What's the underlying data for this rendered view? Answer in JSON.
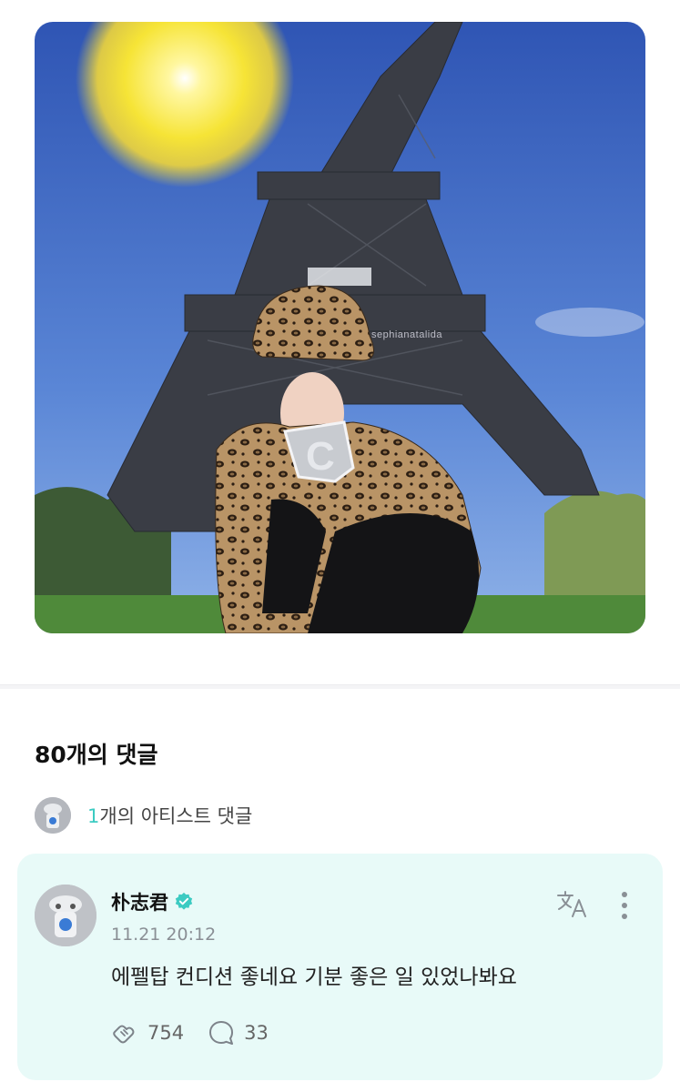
{
  "post": {
    "watermark": "sephianatalida"
  },
  "comments": {
    "count_label": "80개의 댓글",
    "artist_comments": {
      "count": "1",
      "label": "개의 아티스트 댓글"
    }
  },
  "comment": {
    "username": "朴志君",
    "timestamp": "11.21 20:12",
    "text": "에펠탑 컨디션 좋네요 기분 좋은 일 있었나봐요",
    "likes": "754",
    "replies": "33"
  },
  "colors": {
    "accent": "#3ccbc2",
    "card_background": "#e8faf8",
    "sky": "#3f6bc4",
    "sun": "#f4e23a"
  },
  "icons": {
    "verified": "verified-badge-icon",
    "translate": "translate-icon",
    "more": "more-vertical-icon",
    "like": "like-icon",
    "reply": "reply-icon"
  }
}
